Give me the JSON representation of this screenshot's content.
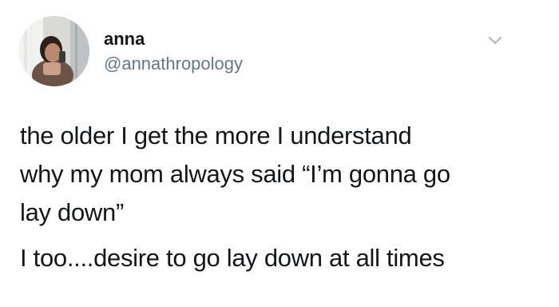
{
  "tweet": {
    "author": {
      "display_name": "anna",
      "handle": "@annathropology",
      "avatar_icon": "profile-photo"
    },
    "menu_icon": "chevron-down-icon",
    "body": {
      "paragraph_1": "the older I get the more I understand\nwhy my mom always said “I’m gonna go\nlay down”",
      "paragraph_2": "I too....desire to go lay down at all times"
    }
  },
  "colors": {
    "text": "#14171a",
    "secondary_text": "#657786",
    "icon": "#aab8c2",
    "background": "#ffffff"
  }
}
